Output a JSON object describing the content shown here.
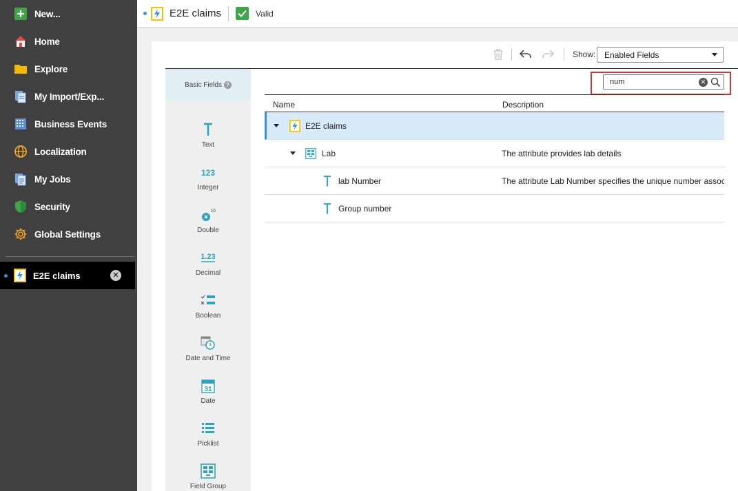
{
  "sidebar": {
    "new_label": "New...",
    "items": [
      {
        "label": "Home",
        "icon": "home-icon"
      },
      {
        "label": "Explore",
        "icon": "folder-icon"
      },
      {
        "label": "My Import/Exp...",
        "icon": "import-export-icon"
      },
      {
        "label": "Business Events",
        "icon": "business-events-icon"
      },
      {
        "label": "Localization",
        "icon": "globe-icon"
      },
      {
        "label": "My Jobs",
        "icon": "jobs-icon"
      },
      {
        "label": "Security",
        "icon": "shield-icon"
      },
      {
        "label": "Global Settings",
        "icon": "gear-icon"
      }
    ],
    "open_tab": {
      "label": "E2E claims",
      "icon": "business-entity-icon"
    }
  },
  "header": {
    "title": "E2E claims",
    "status": "Valid"
  },
  "toolbar": {
    "show_label": "Show:",
    "show_value": "Enabled Fields"
  },
  "fields_panel": {
    "title": "Basic Fields",
    "help": "?",
    "types": [
      {
        "label": "Text",
        "icon": "text-icon"
      },
      {
        "label": "Integer",
        "icon": "integer-icon"
      },
      {
        "label": "Double",
        "icon": "double-icon"
      },
      {
        "label": "Decimal",
        "icon": "decimal-icon"
      },
      {
        "label": "Boolean",
        "icon": "boolean-icon"
      },
      {
        "label": "Date and Time",
        "icon": "date-time-icon"
      },
      {
        "label": "Date",
        "icon": "date-icon"
      },
      {
        "label": "Picklist",
        "icon": "picklist-icon"
      },
      {
        "label": "Field Group",
        "icon": "field-group-icon"
      }
    ]
  },
  "search": {
    "value": "num"
  },
  "table": {
    "columns": {
      "name": "Name",
      "description": "Description"
    },
    "rows": [
      {
        "name": "E2E claims",
        "description": "",
        "level": 0
      },
      {
        "name": "Lab",
        "description": "The attribute provides lab details",
        "level": 1
      },
      {
        "name": "lab Number",
        "description": "The attribute Lab Number specifies the unique number associated",
        "level": 2
      },
      {
        "name": "Group number",
        "description": "",
        "level": 2
      }
    ]
  },
  "colors": {
    "sidebar_bg": "#404040",
    "accent_blue": "#3b8fdc",
    "valid_green": "#3fa548",
    "highlight_red": "#d63333",
    "teal_icon": "#2aa7bf"
  }
}
